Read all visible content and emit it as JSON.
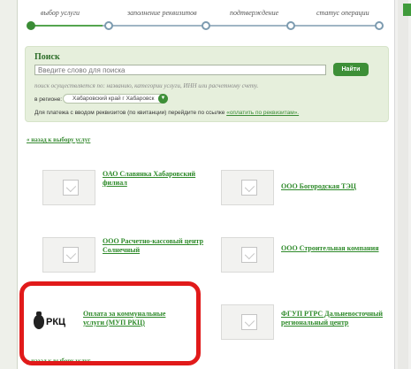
{
  "steps": [
    {
      "label": "выбор услуги",
      "active": true
    },
    {
      "label": "заполнение реквизитов",
      "active": false
    },
    {
      "label": "подтверждение",
      "active": false
    },
    {
      "label": "статус операции",
      "active": false
    }
  ],
  "search": {
    "title": "Поиск",
    "placeholder": "Введите слово для поиска",
    "button": "Найти",
    "hint": "поиск осуществляется по: названию, категории услуги, ИНН или расчетному счету.",
    "region_label": "в регионе:",
    "region_value": "Хабаровский край г Хабаровск",
    "requisites_text": "Для платежа с вводом реквизитов (по квитанции) перейдите по ссылке",
    "requisites_link": "«оплатить по реквизитам»."
  },
  "back_link": "« назад к выбору услуг",
  "providers": [
    {
      "name": "ОАО Славянка Хабаровский филиал"
    },
    {
      "name": "ООО Богородская ТЭЦ"
    },
    {
      "name": "ООО Расчетно-кассовый центр Солнечный"
    },
    {
      "name": "ООО Строительная компания"
    },
    {
      "name": "Оплата за коммунальные услуги (МУП РКЦ)",
      "logo_text": "РКЦ"
    },
    {
      "name": "ФГУП РТРС Дальневосточный региональный центр"
    }
  ],
  "colors": {
    "accent": "#3a8c35",
    "highlight": "#e11a1a"
  }
}
